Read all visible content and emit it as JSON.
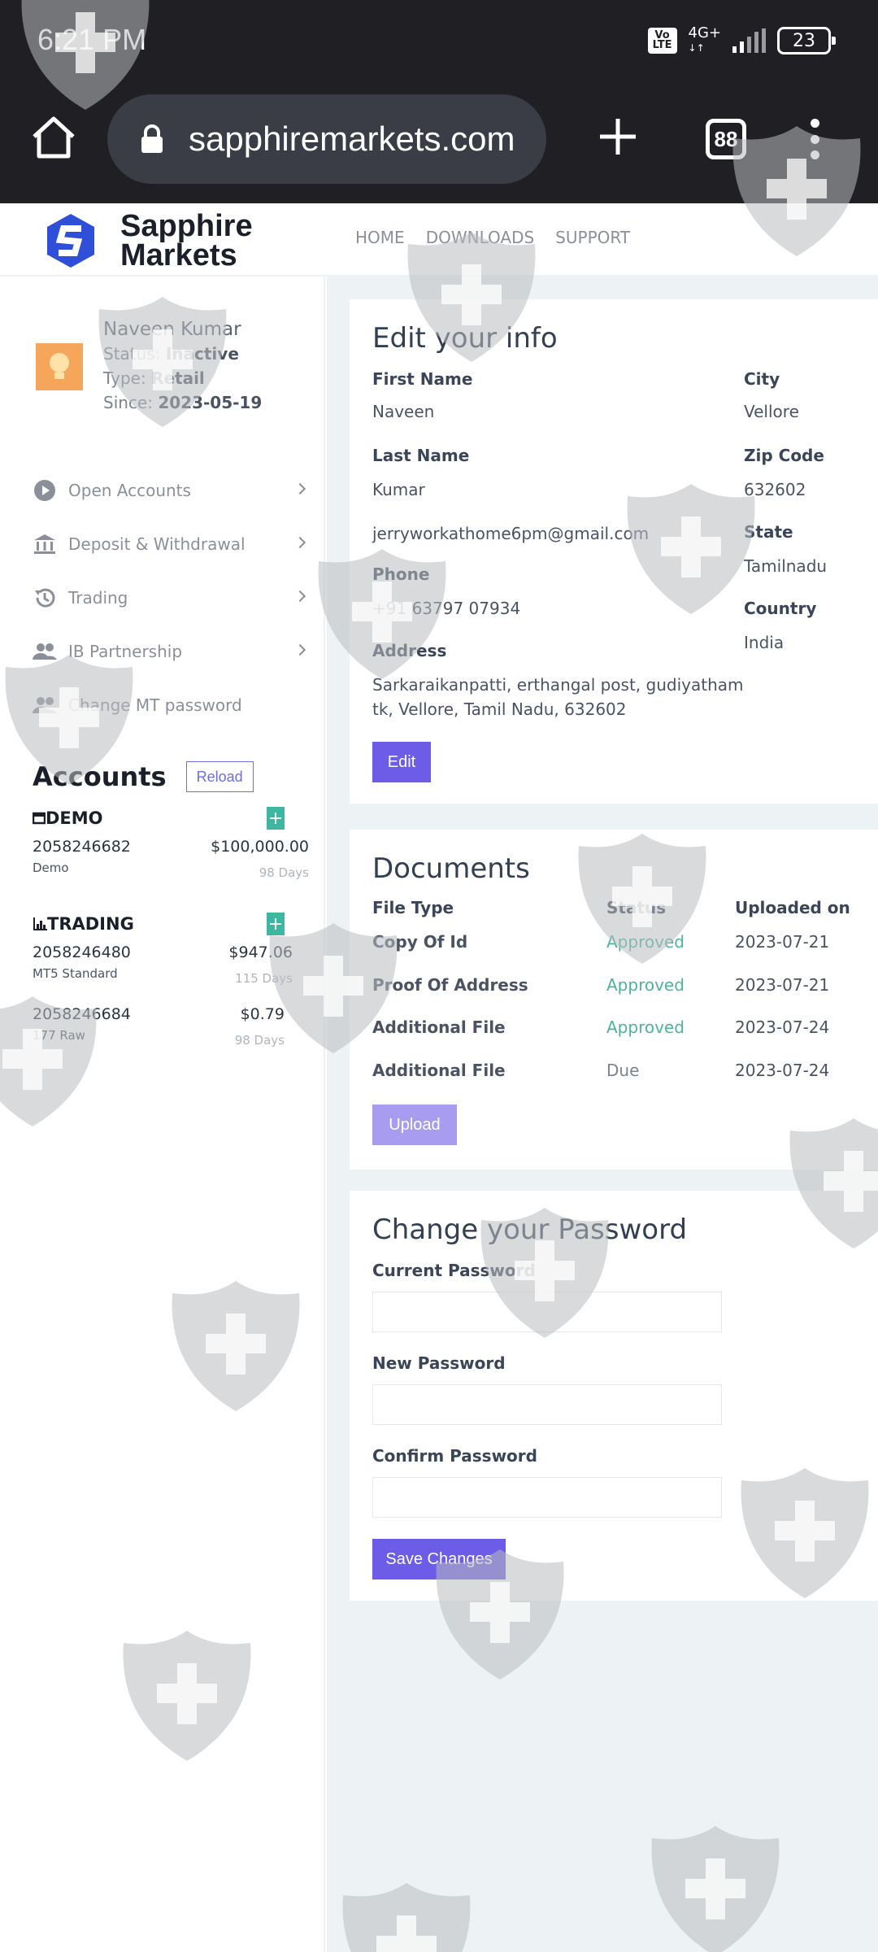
{
  "status_bar": {
    "time": "6:21 PM",
    "network": "4G+",
    "volte_top": "Vo",
    "volte_bottom": "LTE",
    "battery": "23"
  },
  "browser": {
    "url": "sapphiremarkets.com",
    "tab_count": "88"
  },
  "site": {
    "logo_line1": "Sapphire",
    "logo_line2": "Markets",
    "nav": [
      "HOME",
      "DOWNLOADS",
      "SUPPORT"
    ]
  },
  "profile": {
    "name": "Naveen Kumar",
    "status_label": "Status:",
    "status_value": "Inactive",
    "type_label": "Type:",
    "type_value": "Retail",
    "since_label": "Since:",
    "since_value": "2023-05-19"
  },
  "menu": [
    {
      "label": "Open Accounts",
      "icon": "play-circle-icon"
    },
    {
      "label": "Deposit & Withdrawal",
      "icon": "bank-icon"
    },
    {
      "label": "Trading",
      "icon": "history-icon"
    },
    {
      "label": "IB Partnership",
      "icon": "people-icon"
    },
    {
      "label": "Change MT password",
      "icon": "people-icon"
    }
  ],
  "accounts": {
    "title": "Accounts",
    "reload": "Reload",
    "demo_label": "DEMO",
    "trading_label": "TRADING",
    "demo": [
      {
        "number": "2058246682",
        "type": "Demo",
        "amount": "$100,000.00",
        "days": "98 Days"
      }
    ],
    "trading": [
      {
        "number": "2058246480",
        "type": "MT5 Standard",
        "amount": "$947.06",
        "days": "115 Days"
      },
      {
        "number": "2058246684",
        "type": "177 Raw",
        "amount": "$0.79",
        "days": "98 Days"
      }
    ]
  },
  "edit_info": {
    "title": "Edit your info",
    "first_name_label": "First Name",
    "first_name": "Naveen",
    "last_name_label": "Last Name",
    "last_name": "Kumar",
    "email": "jerryworkathome6pm@gmail.com",
    "phone_label": "Phone",
    "phone": "+91 63797 07934",
    "address_label": "Address",
    "address_line1": "Sarkaraikanpatti, erthangal post, gudiyatham",
    "address_line2": "tk, Vellore, Tamil Nadu, 632602",
    "city_label": "City",
    "city": "Vellore",
    "zip_label": "Zip Code",
    "zip": "632602",
    "state_label": "State",
    "state": "Tamilnadu",
    "country_label": "Country",
    "country": "India",
    "edit_button": "Edit"
  },
  "documents": {
    "title": "Documents",
    "col_type": "File Type",
    "col_status": "Status",
    "col_uploaded": "Uploaded on",
    "rows": [
      {
        "type": "Copy Of Id",
        "status": "Approved",
        "date": "2023-07-21"
      },
      {
        "type": "Proof Of Address",
        "status": "Approved",
        "date": "2023-07-21"
      },
      {
        "type": "Additional File",
        "status": "Approved",
        "date": "2023-07-24"
      },
      {
        "type": "Additional File",
        "status": "Due",
        "date": "2023-07-24"
      }
    ],
    "upload_button": "Upload"
  },
  "password": {
    "title": "Change your Password",
    "current_label": "Current Password",
    "new_label": "New Password",
    "confirm_label": "Confirm Password",
    "save_button": "Save Changes"
  },
  "colors": {
    "primary": "#6c5ce7",
    "approved": "#4bb39e",
    "brand_blue": "#2f4fd8",
    "accent_green": "#3db7a0"
  }
}
